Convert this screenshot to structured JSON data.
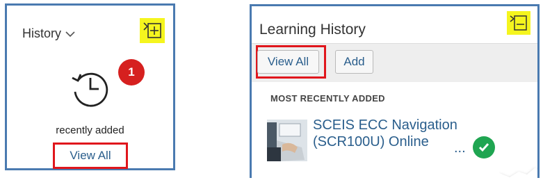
{
  "colors": {
    "panel_border": "#4a7ab0",
    "highlight_yellow": "#f5f51e",
    "red_outline": "#e0161c",
    "badge_red": "#d6201f",
    "link_blue": "#2a5e8c",
    "check_green": "#1fa551"
  },
  "left_panel": {
    "title": "History",
    "title_icon": "chevron-down-icon",
    "add_icon": "add-to-list-icon",
    "history_icon": "history-clock-icon",
    "badge_count": "1",
    "caption": "recently added",
    "view_all_label": "View All"
  },
  "right_panel": {
    "title": "Learning History",
    "add_icon": "add-to-list-icon",
    "toolbar": {
      "view_all_label": "View All",
      "add_label": "Add"
    },
    "section_title": "MOST RECENTLY ADDED",
    "items": [
      {
        "title": "SCEIS ECC Navigation (SCR100U) Online",
        "thumbnail_icon": "computer-user-thumbnail",
        "status_icon": "check-circle-icon",
        "truncation": "..."
      }
    ]
  }
}
